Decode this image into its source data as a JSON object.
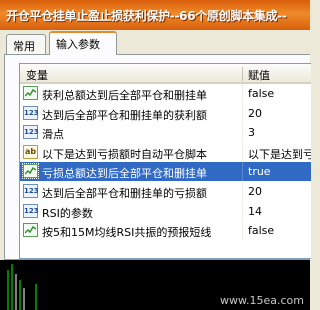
{
  "window": {
    "title": "开仓平仓挂单止盈止损获利保护--66个原创脚本集成--"
  },
  "tabs": [
    {
      "label": "常用",
      "active": false
    },
    {
      "label": "输入参数",
      "active": true
    }
  ],
  "grid": {
    "headers": {
      "variable": "变量",
      "value": "赋值"
    },
    "rows": [
      {
        "icon": "chart-icon",
        "name": "获利总额达到后全部平仓和删挂单",
        "value": "false",
        "selected": false
      },
      {
        "icon": "123-icon",
        "name": "达到后全部平仓和删挂单的获利额",
        "value": "20",
        "selected": false
      },
      {
        "icon": "123-icon",
        "name": "滑点",
        "value": "3",
        "selected": false
      },
      {
        "icon": "ab-icon",
        "name": "以下是达到亏损额时自动平仓脚本",
        "value": "以下是达到亏",
        "selected": false
      },
      {
        "icon": "chart-icon",
        "name": "亏损总额达到后全部平仓和删挂单",
        "value": "true",
        "selected": true
      },
      {
        "icon": "123-icon",
        "name": "达到后全部平仓和删挂单的亏损额",
        "value": "20",
        "selected": false
      },
      {
        "icon": "123-icon",
        "name": "RSI的参数",
        "value": "14",
        "selected": false
      },
      {
        "icon": "chart-icon",
        "name": "按5和15M均线RSI共振的预报短线",
        "value": "false",
        "selected": false
      }
    ]
  },
  "watermark": "www.15ea.com",
  "colors": {
    "title_bar": "#e0701a",
    "selection": "#316ac5",
    "tab_accent": "#e68b2c"
  }
}
